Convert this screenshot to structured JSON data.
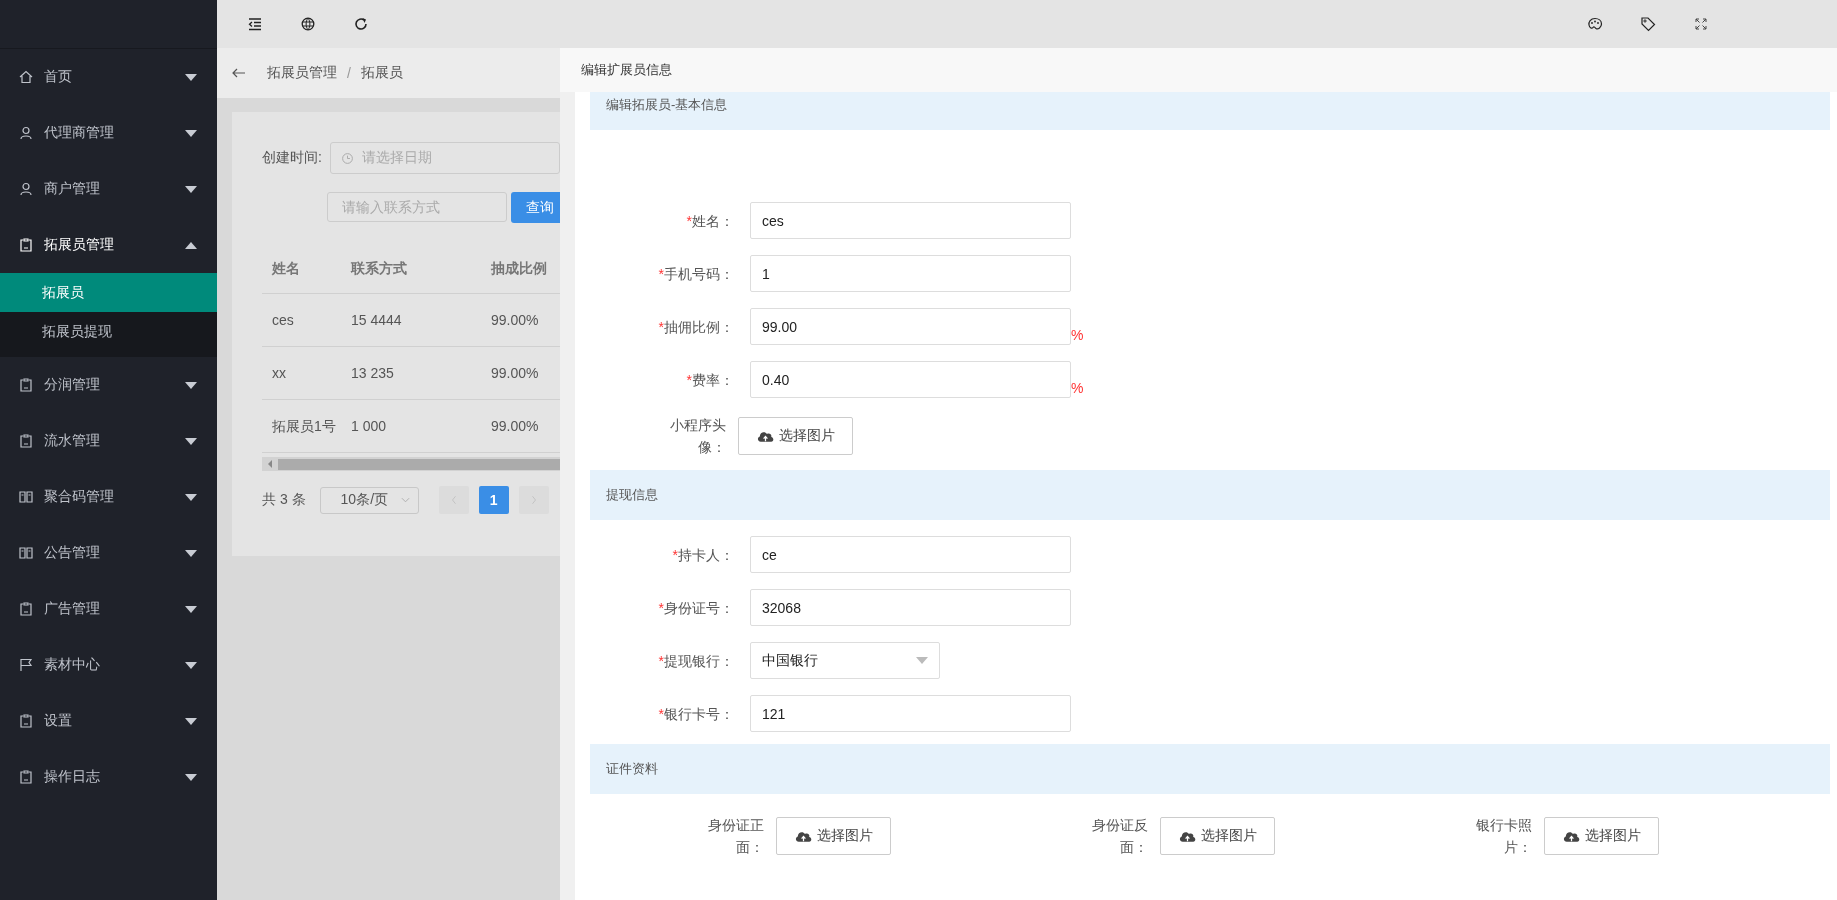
{
  "sidebar": {
    "items": [
      {
        "label": "首页",
        "expanded": false
      },
      {
        "label": "代理商管理",
        "expanded": false
      },
      {
        "label": "商户管理",
        "expanded": false
      },
      {
        "label": "拓展员管理",
        "expanded": true,
        "children": [
          {
            "label": "拓展员",
            "selected": true
          },
          {
            "label": "拓展员提现",
            "selected": false
          }
        ]
      },
      {
        "label": "分润管理",
        "expanded": false
      },
      {
        "label": "流水管理",
        "expanded": false
      },
      {
        "label": "聚合码管理",
        "expanded": false
      },
      {
        "label": "公告管理",
        "expanded": false
      },
      {
        "label": "广告管理",
        "expanded": false
      },
      {
        "label": "素材中心",
        "expanded": false
      },
      {
        "label": "设置",
        "expanded": false
      },
      {
        "label": "操作日志",
        "expanded": false
      }
    ]
  },
  "breadcrumb": {
    "separator": "/",
    "items": [
      "拓展员管理",
      "拓展员"
    ]
  },
  "filters": {
    "date_label": "创建时间:",
    "date_placeholder": "请选择日期",
    "contact_placeholder": "请输入联系方式",
    "search_button": "查询"
  },
  "table": {
    "columns": [
      "姓名",
      "联系方式",
      "抽成比例"
    ],
    "rows": [
      [
        "ces",
        "15 4444",
        "99.00%"
      ],
      [
        "xx",
        "13 235",
        "99.00%"
      ],
      [
        "拓展员1号",
        "1 000",
        "99.00%"
      ]
    ]
  },
  "pagination": {
    "total": "共 3 条",
    "page_size": "10条/页",
    "pages": [
      {
        "label": "1",
        "selected": true
      }
    ]
  },
  "drawer": {
    "title": "编辑扩展员信息",
    "required_mark": "*",
    "sections": [
      {
        "title": "编辑拓展员-基本信息",
        "kind": "form",
        "fields": [
          {
            "label": "姓名：",
            "required": true,
            "kind": "input",
            "value": "ces"
          },
          {
            "label": "手机号码：",
            "required": true,
            "kind": "input",
            "value": "1"
          },
          {
            "label": "抽佣比例：",
            "required": true,
            "kind": "input",
            "value": "99.00",
            "suffix": "%"
          },
          {
            "label": "费率：",
            "required": true,
            "kind": "input",
            "value": "0.40",
            "suffix": "%"
          },
          {
            "label": "小程序头像：",
            "required": false,
            "kind": "upload",
            "value": "选择图片"
          }
        ]
      },
      {
        "title": "提现信息",
        "kind": "form",
        "fields": [
          {
            "label": "持卡人：",
            "required": true,
            "kind": "input",
            "value": "ce"
          },
          {
            "label": "身份证号：",
            "required": true,
            "kind": "input",
            "value": "32068"
          },
          {
            "label": "提现银行：",
            "required": true,
            "kind": "select",
            "value": "中国银行"
          },
          {
            "label": "银行卡号：",
            "required": true,
            "kind": "input",
            "value": "121"
          }
        ]
      },
      {
        "title": "证件资料",
        "kind": "uploads",
        "fields": [
          {
            "label": "身份证正面：",
            "required": false,
            "kind": "upload",
            "value": "选择图片"
          },
          {
            "label": "身份证反面：",
            "required": false,
            "kind": "upload",
            "value": "选择图片"
          },
          {
            "label": "银行卡照片：",
            "required": false,
            "kind": "upload",
            "value": "选择图片"
          }
        ]
      }
    ]
  }
}
